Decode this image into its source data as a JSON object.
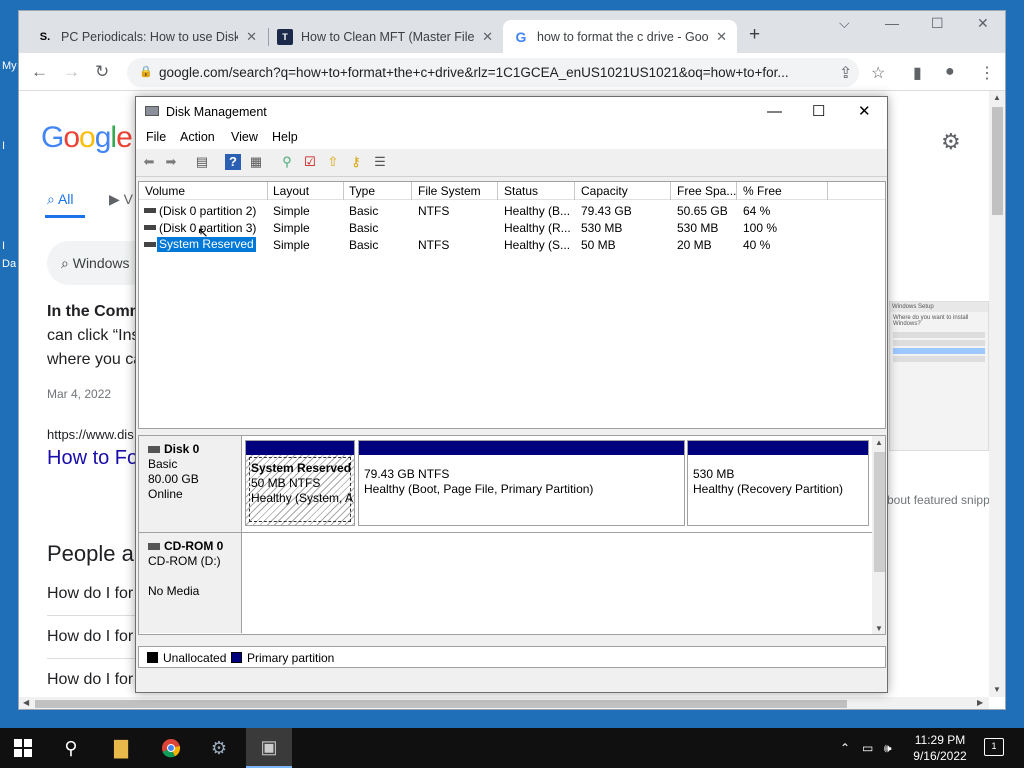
{
  "desktop": {
    "icon_labels": [
      "My",
      "I",
      "I",
      "Da"
    ]
  },
  "browser": {
    "tabs": [
      {
        "favicon": "S.",
        "title": "PC Periodicals: How to use DiskP",
        "close": "✕"
      },
      {
        "favicon": "T",
        "title": "How to Clean MFT (Master File T",
        "close": "✕"
      },
      {
        "favicon": "G",
        "title": "how to format the c drive - Goo",
        "close": "✕"
      }
    ],
    "new_tab": "+",
    "window_controls": {
      "dropdown": "⌵",
      "minimize": "—",
      "maximize": "☐",
      "close": "✕"
    },
    "nav": {
      "back": "←",
      "forward": "→",
      "reload": "↻"
    },
    "url": "google.com/search?q=how+to+format+the+c+drive&rlz=1C1GCEA_enUS1021US1021&oq=how+to+for...",
    "toolbar_icons": {
      "share": "⇪",
      "bookmark": "☆",
      "sidebar": "▮",
      "profile": "●",
      "menu": "⋮"
    }
  },
  "google": {
    "logo_letters": [
      "G",
      "o",
      "o",
      "g",
      "l",
      "e"
    ],
    "tab_all": "All",
    "tab_videos": "V",
    "search_chip": "Windows",
    "snippet_bold": "In the Comm",
    "snippet_line2": "can click “Ins",
    "snippet_line3": "where you ca",
    "date": "Mar 4, 2022",
    "url_text": "https://www.dis",
    "link_title": "How to Fo",
    "people_heading": "People al",
    "questions": [
      "How do I for",
      "How do I for",
      "How do I for"
    ],
    "featured_text": "bout featured snipp",
    "thumb_title": "Windows Setup",
    "thumb_question": "Where do you want to install Windows?"
  },
  "disk_management": {
    "title": "Disk Management",
    "window_controls": {
      "minimize": "—",
      "maximize": "☐",
      "close": "✕"
    },
    "menu": [
      "File",
      "Action",
      "View",
      "Help"
    ],
    "columns": [
      "Volume",
      "Layout",
      "Type",
      "File System",
      "Status",
      "Capacity",
      "Free Spa...",
      "% Free"
    ],
    "volumes": [
      {
        "volume": "(Disk 0 partition 2)",
        "layout": "Simple",
        "type": "Basic",
        "fs": "NTFS",
        "status": "Healthy (B...",
        "capacity": "79.43 GB",
        "free": "50.65 GB",
        "pct": "64 %"
      },
      {
        "volume": "(Disk 0 partition 3)",
        "layout": "Simple",
        "type": "Basic",
        "fs": "",
        "status": "Healthy (R...",
        "capacity": "530 MB",
        "free": "530 MB",
        "pct": "100 %"
      },
      {
        "volume": "System Reserved",
        "layout": "Simple",
        "type": "Basic",
        "fs": "NTFS",
        "status": "Healthy (S...",
        "capacity": "50 MB",
        "free": "20 MB",
        "pct": "40 %"
      }
    ],
    "disk0": {
      "name": "Disk 0",
      "type": "Basic",
      "size": "80.00 GB",
      "state": "Online",
      "partitions": [
        {
          "name": "System Reserved",
          "size": "50 MB NTFS",
          "status": "Healthy (System, A"
        },
        {
          "name": "",
          "size": "79.43 GB NTFS",
          "status": "Healthy (Boot, Page File, Primary Partition)"
        },
        {
          "name": "",
          "size": "530 MB",
          "status": "Healthy (Recovery Partition)"
        }
      ]
    },
    "cdrom": {
      "name": "CD-ROM 0",
      "drive": "CD-ROM (D:)",
      "media": "No Media"
    },
    "legend": [
      "Unallocated",
      "Primary partition"
    ],
    "colors": {
      "primary_partition": "#00007f",
      "unallocated": "#000000",
      "selection": "#0078d7"
    }
  },
  "taskbar": {
    "time": "11:29 PM",
    "date": "9/16/2022",
    "notifications": "1",
    "tray_icons": {
      "chevron": "⌃",
      "network": "▭",
      "volume": "🕪"
    }
  }
}
